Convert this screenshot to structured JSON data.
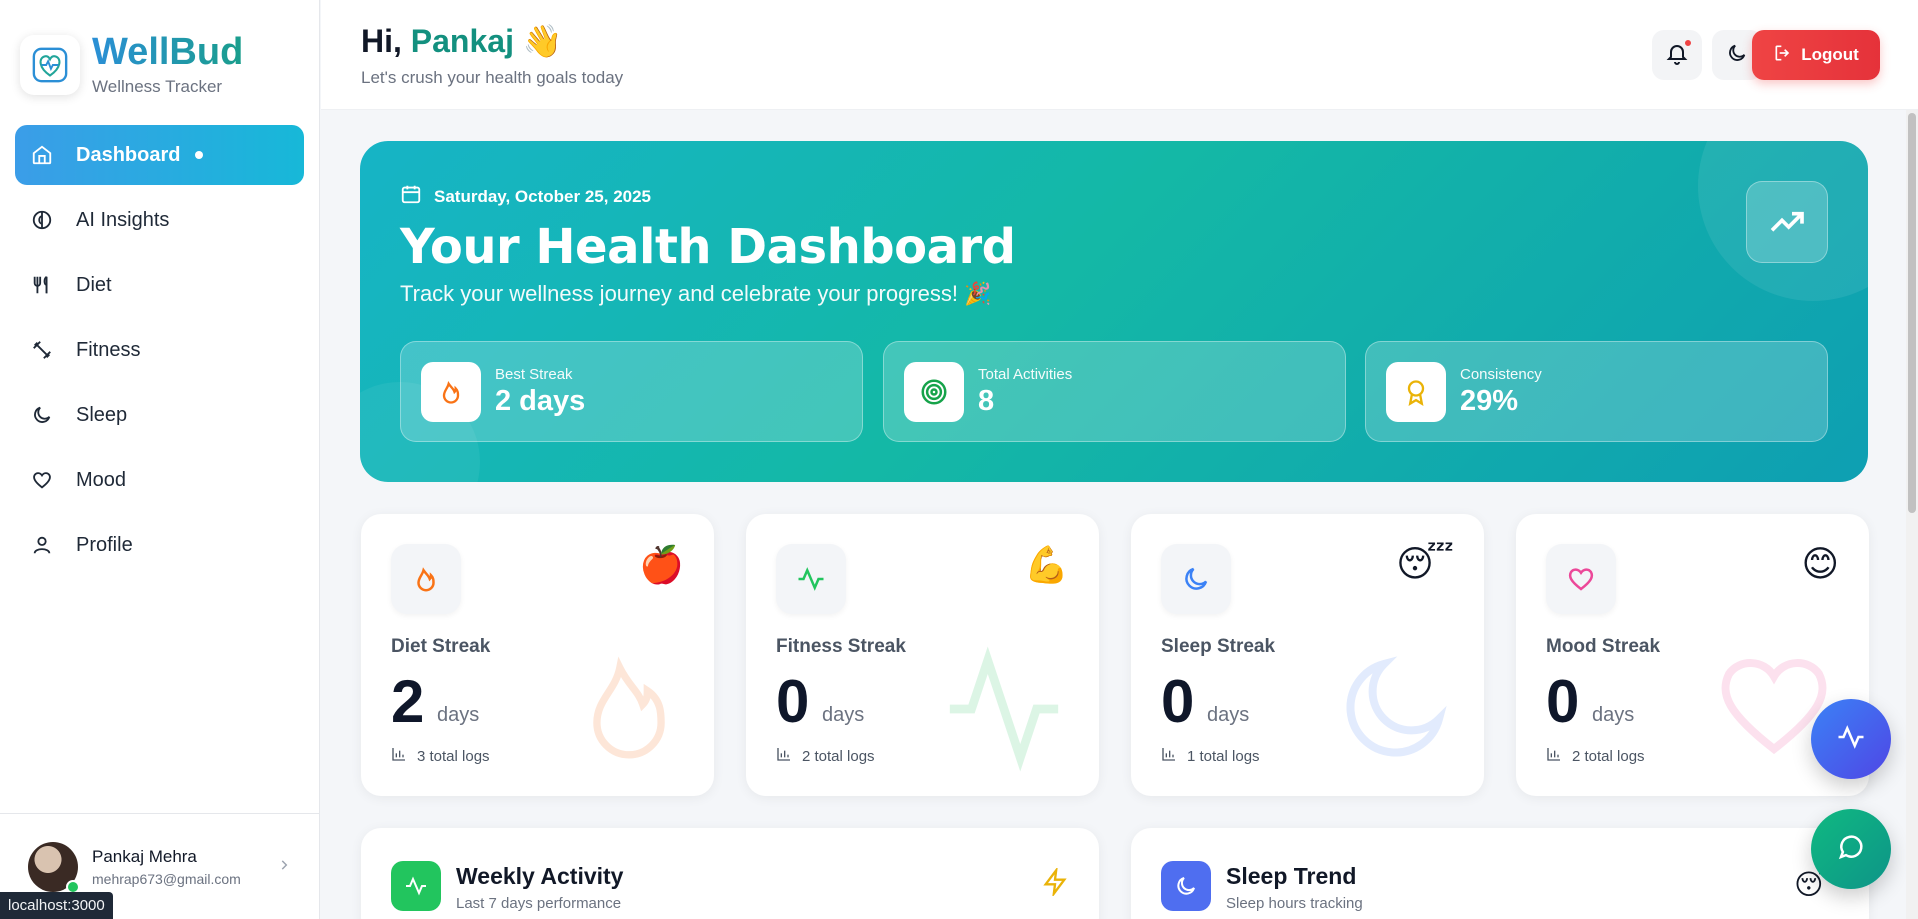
{
  "brand": {
    "title": "WellBud",
    "subtitle": "Wellness Tracker"
  },
  "nav": {
    "items": [
      {
        "label": "Dashboard",
        "icon": "home-icon",
        "active": true
      },
      {
        "label": "AI Insights",
        "icon": "brain-icon"
      },
      {
        "label": "Diet",
        "icon": "utensils-icon"
      },
      {
        "label": "Fitness",
        "icon": "dumbbell-icon"
      },
      {
        "label": "Sleep",
        "icon": "moon-icon"
      },
      {
        "label": "Mood",
        "icon": "heart-icon"
      },
      {
        "label": "Profile",
        "icon": "user-icon"
      }
    ]
  },
  "user": {
    "name": "Pankaj Mehra",
    "email": "mehrap673@gmail.com"
  },
  "status_bar": {
    "url": "localhost:3000"
  },
  "header": {
    "greeting": "Hi,",
    "name": "Pankaj",
    "wave": "👋",
    "subtitle": "Let's crush your health goals today",
    "logout_label": "Logout"
  },
  "hero": {
    "date": "Saturday, October 25, 2025",
    "title": "Your Health Dashboard",
    "subtitle": "Track your wellness journey and celebrate your progress! 🎉",
    "stats": [
      {
        "label": "Best Streak",
        "value": "2 days",
        "icon": "flame-icon"
      },
      {
        "label": "Total Activities",
        "value": "8",
        "icon": "target-icon"
      },
      {
        "label": "Consistency",
        "value": "29%",
        "icon": "award-icon"
      }
    ]
  },
  "streaks": [
    {
      "title": "Diet Streak",
      "value": "2",
      "unit": "days",
      "logs": "3 total logs",
      "emoji": "🍎",
      "icon": "flame-icon",
      "color": "#f97316"
    },
    {
      "title": "Fitness Streak",
      "value": "0",
      "unit": "days",
      "logs": "2 total logs",
      "emoji": "💪",
      "icon": "activity-icon",
      "color": "#22c55e"
    },
    {
      "title": "Sleep Streak",
      "value": "0",
      "unit": "days",
      "logs": "1 total logs",
      "emoji": "😴",
      "icon": "moon-icon",
      "color": "#3b82f6"
    },
    {
      "title": "Mood Streak",
      "value": "0",
      "unit": "days",
      "logs": "2 total logs",
      "emoji": "😊",
      "icon": "heart-icon",
      "color": "#ec4899"
    }
  ],
  "panels": [
    {
      "title": "Weekly Activity",
      "subtitle": "Last 7 days performance",
      "icon": "activity-icon",
      "right_icon": "lightning-icon"
    },
    {
      "title": "Sleep Trend",
      "subtitle": "Sleep hours tracking",
      "icon": "moon-icon",
      "right_emoji": "😴"
    }
  ],
  "colors": {
    "brand_blue": "#2b8fd6",
    "accent_teal": "#13907f",
    "hero_gradient": [
      "#16b4c6",
      "#14b8a6",
      "#0e9fb2"
    ],
    "logout_red": "#ef4444"
  }
}
